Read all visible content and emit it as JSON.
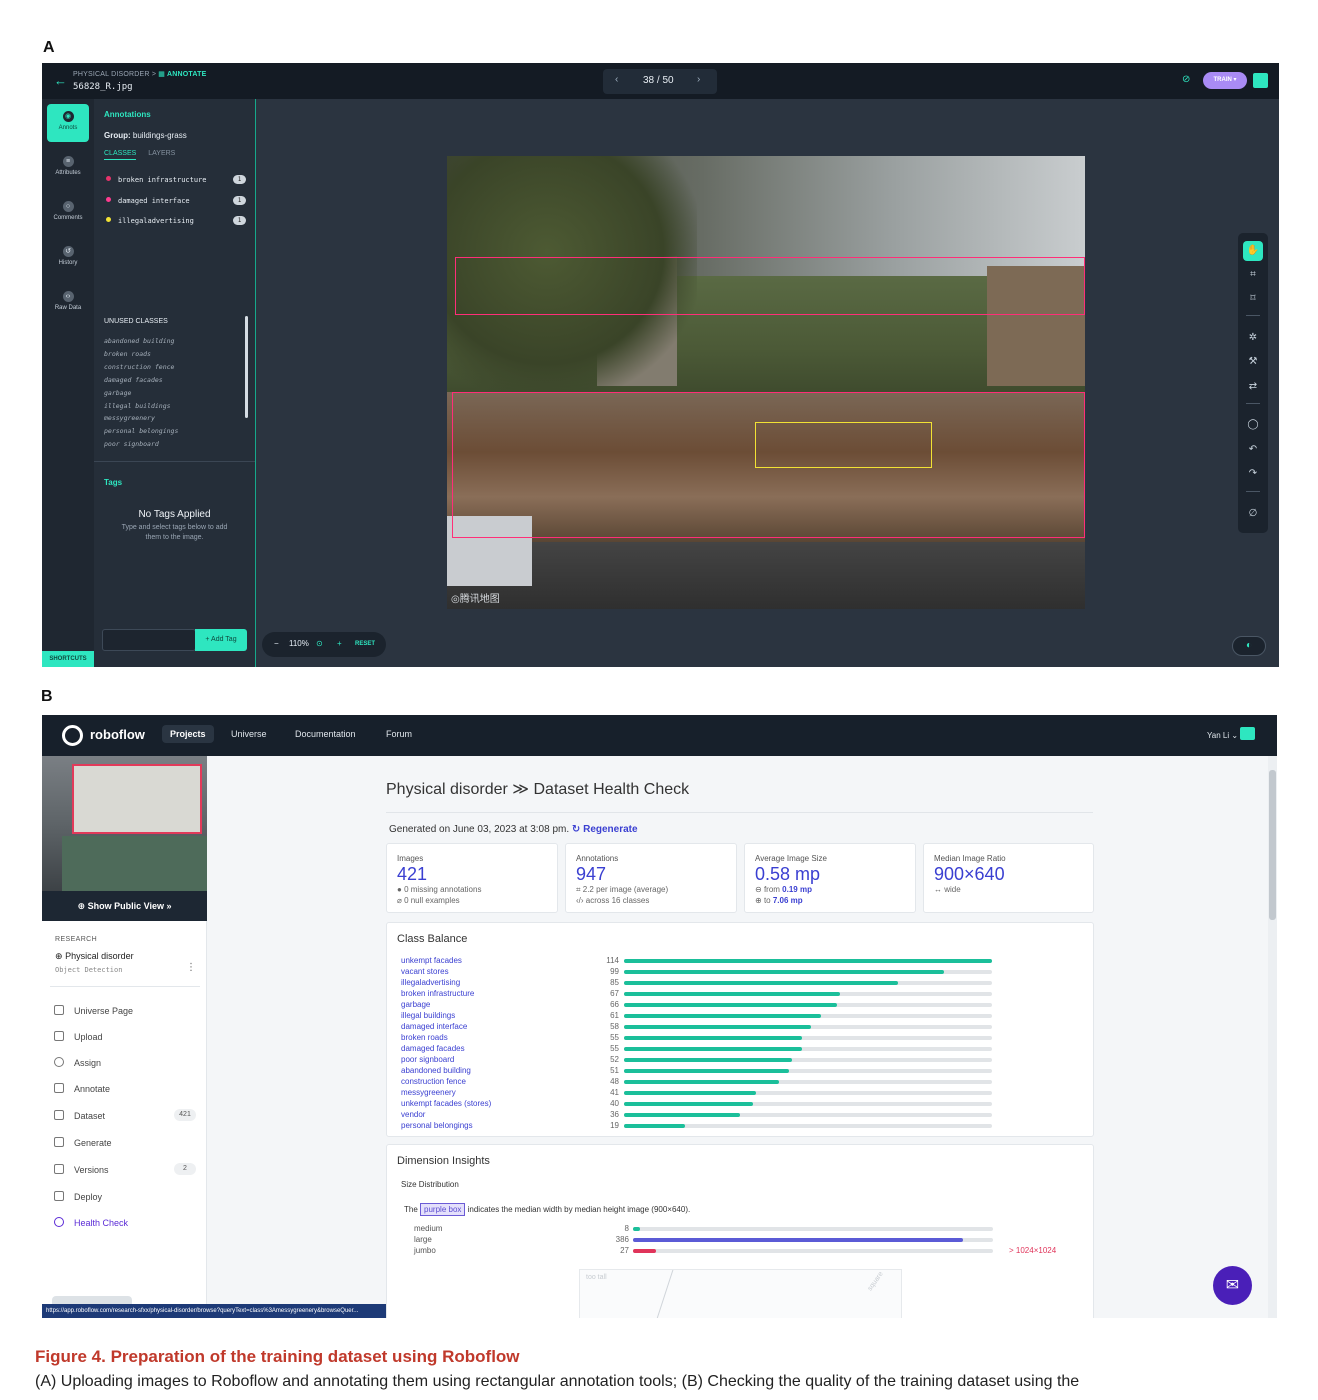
{
  "labels": {
    "panel_a": "A",
    "panel_b": "B"
  },
  "annotate": {
    "breadcrumb_project": "PHYSICAL DISORDER",
    "breadcrumb_sep": ">",
    "breadcrumb_section": "ANNOTATE",
    "filename": "56828_R.jpg",
    "pager": {
      "prev_icon": "chevron-left",
      "count": "38 / 50",
      "next_icon": "chevron-right"
    },
    "train_label": "TRAIN",
    "left_nav": [
      {
        "label": "Annots",
        "icon": "annotation-icon",
        "active": true
      },
      {
        "label": "Attributes",
        "icon": "attributes-icon"
      },
      {
        "label": "Comments",
        "icon": "comments-icon"
      },
      {
        "label": "History",
        "icon": "history-icon"
      },
      {
        "label": "Raw Data",
        "icon": "raw-data-icon"
      }
    ],
    "shortcuts_label": "SHORTCUTS",
    "annotations_heading": "Annotations",
    "group_label": "Group:",
    "group_value": "buildings-grass",
    "tabs": {
      "classes": "CLASSES",
      "layers": "LAYERS"
    },
    "classes": [
      {
        "name": "broken infrastructure",
        "count": "1",
        "color": "#e6336b"
      },
      {
        "name": "damaged interface",
        "count": "1",
        "color": "#ff3b8f"
      },
      {
        "name": "illegaladvertising",
        "count": "1",
        "color": "#f2e234"
      }
    ],
    "unused_heading": "UNUSED CLASSES",
    "unused_classes": [
      "abandoned building",
      "broken roads",
      "construction fence",
      "damaged facades",
      "garbage",
      "illegal buildings",
      "messygreenery",
      "personal belongings",
      "poor signboard"
    ],
    "tags_heading": "Tags",
    "no_tags_title": "No Tags Applied",
    "no_tags_sub": "Type and select tags below to add them to the image.",
    "tag_input_value": "",
    "add_tag_label": "+ Add Tag",
    "zoom": {
      "minus": "−",
      "level": "110%",
      "plus": "+",
      "reset": "RESET"
    },
    "watermark": "◎腾讯地图",
    "colors": {
      "accent": "#2ee6c0",
      "bbox_pink": "#ff2e78",
      "bbox_yellow": "#f2e234",
      "train": "#a98bf5"
    }
  },
  "roboflow": {
    "brand": "roboflow",
    "nav": [
      "Projects",
      "Universe",
      "Documentation",
      "Forum"
    ],
    "user": "Yan Li",
    "show_public_view": "Show Public View »",
    "workspace_label": "RESEARCH",
    "project_name": "Physical disorder",
    "project_type": "Object Detection",
    "sidebar": [
      {
        "label": "Universe Page",
        "icon": "universe-page-icon",
        "count": ""
      },
      {
        "label": "Upload",
        "icon": "upload-icon",
        "count": ""
      },
      {
        "label": "Assign",
        "icon": "assign-icon",
        "count": ""
      },
      {
        "label": "Annotate",
        "icon": "annotate-icon",
        "count": ""
      },
      {
        "label": "Dataset",
        "icon": "dataset-icon",
        "count": "421"
      },
      {
        "label": "Generate",
        "icon": "generate-icon",
        "count": ""
      },
      {
        "label": "Versions",
        "icon": "versions-icon",
        "count": "2"
      },
      {
        "label": "Deploy",
        "icon": "deploy-icon",
        "count": ""
      },
      {
        "label": "Health Check",
        "icon": "health-check-icon",
        "count": "",
        "active": true
      }
    ],
    "status_url": "https://app.roboflow.com/research-sfxx/physical-disorder/browse?queryText=class%3Amessygreenery&browseQuer...",
    "page_title_project": "Physical disorder",
    "page_title_sep": "≫",
    "page_title_page": "Dataset Health Check",
    "generated_text": "Generated on June 03, 2023 at 3:08 pm.",
    "regenerate": "Regenerate",
    "stats": {
      "images": {
        "label": "Images",
        "value": "421",
        "line1": "0 missing annotations",
        "line2": "0 null examples"
      },
      "annotations": {
        "label": "Annotations",
        "value": "947",
        "line1": "2.2 per image (average)",
        "line2": "across 16 classes"
      },
      "avg_size": {
        "label": "Average Image Size",
        "value": "0.58 mp",
        "line1_pre": "from",
        "line1_val": "0.19 mp",
        "line2_pre": "to",
        "line2_val": "7.06 mp"
      },
      "median_ratio": {
        "label": "Median Image Ratio",
        "value": "900×640",
        "line1": "wide"
      }
    },
    "class_balance_title": "Class Balance",
    "class_balance": [
      {
        "name": "unkempt facades",
        "count": 114
      },
      {
        "name": "vacant stores",
        "count": 99
      },
      {
        "name": "illegaladvertising",
        "count": 85
      },
      {
        "name": "broken infrastructure",
        "count": 67
      },
      {
        "name": "garbage",
        "count": 66
      },
      {
        "name": "illegal buildings",
        "count": 61
      },
      {
        "name": "damaged interface",
        "count": 58
      },
      {
        "name": "broken roads",
        "count": 55
      },
      {
        "name": "damaged facades",
        "count": 55
      },
      {
        "name": "poor signboard",
        "count": 52
      },
      {
        "name": "abandoned building",
        "count": 51
      },
      {
        "name": "construction fence",
        "count": 48
      },
      {
        "name": "messygreenery",
        "count": 41
      },
      {
        "name": "unkempt facades (stores)",
        "count": 40
      },
      {
        "name": "vendor",
        "count": 36
      },
      {
        "name": "personal belongings",
        "count": 19
      }
    ],
    "class_balance_max": 114,
    "dimension_title": "Dimension Insights",
    "size_dist_title": "Size Distribution",
    "median_note_pre": "The",
    "median_note_box": "purple box",
    "median_note_post": "indicates the median width by median height image (900×640).",
    "size_distribution": [
      {
        "name": "medium",
        "count": 8,
        "color": "#1bbf9a"
      },
      {
        "name": "large",
        "count": 386,
        "color": "#5b5bd6"
      },
      {
        "name": "jumbo",
        "count": 27,
        "color": "#e0345a"
      }
    ],
    "size_total": 421,
    "jumbo_note": "> 1024×1024",
    "scatter_label_tall": "too tall",
    "scatter_label_square": "square",
    "colors": {
      "bar": "#1bbf9a",
      "link": "#3a3fd1",
      "nav_bg": "#17202b",
      "chat": "#4a1fb8"
    }
  },
  "caption": {
    "title": "Figure 4.  Preparation of the training dataset using Roboflow",
    "text": "(A) Uploading images to Roboflow and annotating them using rectangular annotation tools; (B) Checking the quality of the training dataset using the"
  }
}
